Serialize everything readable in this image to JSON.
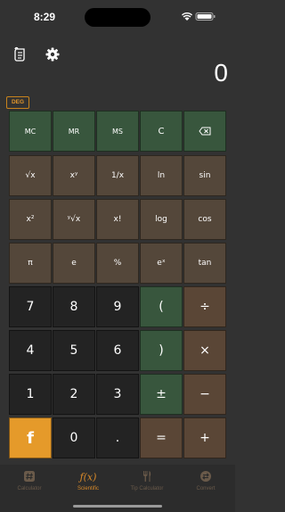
{
  "status": {
    "time": "8:29"
  },
  "display": {
    "value": "0",
    "mode_badge": "DEG"
  },
  "toolbar": {
    "history_icon": "scroll-icon",
    "settings_icon": "gear-icon"
  },
  "keys": {
    "mc": "MC",
    "mr": "MR",
    "ms": "MS",
    "clear": "C",
    "sqrt": "√x",
    "x_pow_y": "xʸ",
    "reciprocal": "1/x",
    "ln": "ln",
    "sin": "sin",
    "x_squared": "x²",
    "y_root_x": "ʸ√x",
    "factorial": "x!",
    "log": "log",
    "cos": "cos",
    "pi": "π",
    "e": "e",
    "percent": "%",
    "e_pow_x": "eˣ",
    "tan": "tan",
    "seven": "7",
    "eight": "8",
    "nine": "9",
    "paren_open": "(",
    "divide": "÷",
    "four": "4",
    "five": "5",
    "six": "6",
    "paren_close": ")",
    "multiply": "×",
    "one": "1",
    "two": "2",
    "three": "3",
    "plus_minus": "±",
    "minus": "−",
    "function": "f",
    "zero": "0",
    "decimal": ".",
    "equals": "=",
    "plus": "+"
  },
  "tabs": [
    {
      "label": "Calculator",
      "icon": "hash-icon",
      "active": false
    },
    {
      "label": "Scientific",
      "icon": "function-icon",
      "active": true
    },
    {
      "label": "Tip Calculator",
      "icon": "fork-knife-icon",
      "active": false
    },
    {
      "label": "Convert",
      "icon": "convert-icon",
      "active": false
    }
  ],
  "colors": {
    "background": "#323232",
    "memory_key": "#38563d",
    "scientific_key": "#54473a",
    "number_key": "#232323",
    "accent": "#e59a2a"
  }
}
